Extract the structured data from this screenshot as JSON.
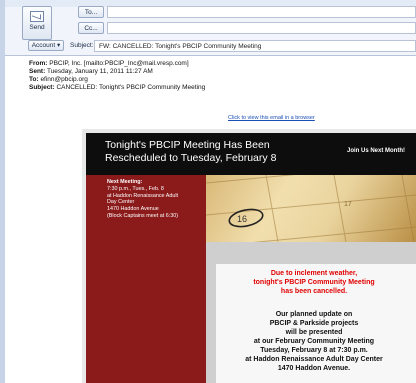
{
  "compose": {
    "send_label": "Send",
    "to_label": "To...",
    "cc_label": "Cc...",
    "account_label": "Account",
    "subject_label": "Subject:",
    "subject_value": "FW: CANCELLED: Tonight's PBCIP Community Meeting"
  },
  "message_meta": {
    "from_label": "From:",
    "from_value": "PBCIP, Inc. [mailto:PBCIP_Inc@mail.vresp.com]",
    "sent_label": "Sent:",
    "sent_value": "Tuesday, January 11, 2011 11:27 AM",
    "to_label": "To:",
    "to_value": "efinn@pbcip.org",
    "subject_label": "Subject:",
    "subject_value": "CANCELLED: Tonight's PBCIP Community Meeting"
  },
  "view_link": "Click to view this email in a browser",
  "newsletter": {
    "title_line1": "Tonight's PBCIP Meeting Has Been",
    "title_line2": "Rescheduled to Tuesday, February 8",
    "join": "Join Us Next Month!",
    "next_meeting_label": "Next Meeting:",
    "next_meeting_lines": [
      "7:30 p.m., Tues., Feb. 8",
      "at Haddon Renaissance Adult",
      "Day Center",
      "1470 Haddon Avenue",
      "(Block Captains meet at 6:30)"
    ],
    "calendar_numbers": [
      "16",
      "17"
    ],
    "alert_lines": [
      "Due to inclement weather,",
      "tonight's PBCIP Community Meeting",
      "has been cancelled."
    ],
    "update_lines": [
      "Our planned update on",
      "PBCIP & Parkside projects",
      "will be presented",
      "at our February Community Meeting",
      "Tuesday, February 8 at 7:30 p.m.",
      "at Haddon Renaissance Adult Day Center",
      "1470 Haddon Avenue."
    ]
  }
}
